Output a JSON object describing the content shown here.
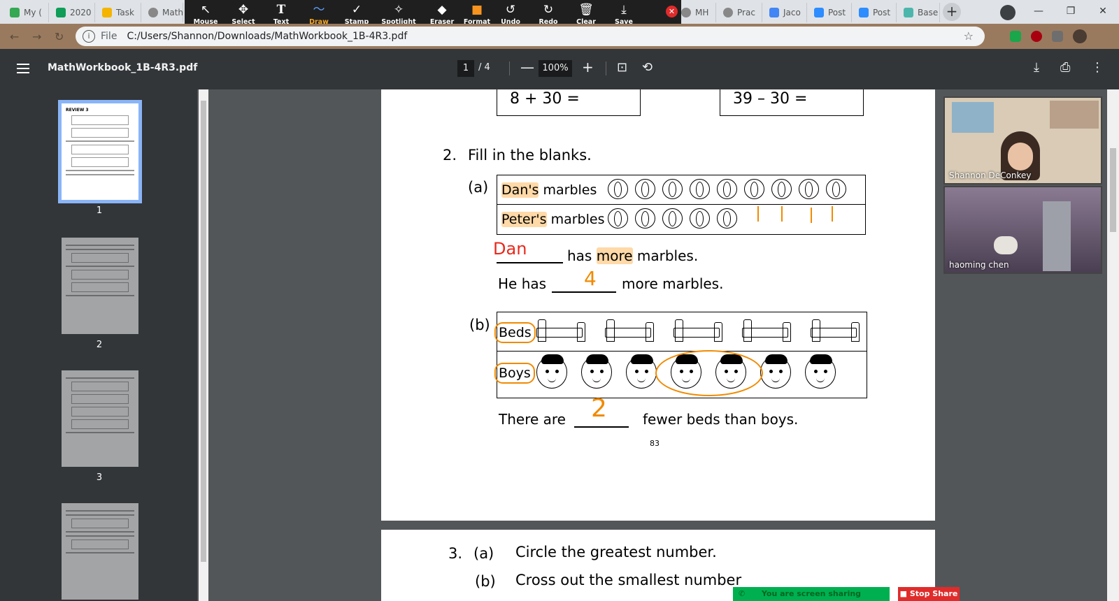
{
  "browser": {
    "tabs": [
      {
        "label": "My (",
        "icon": "drive-icon",
        "color": "#34a853"
      },
      {
        "label": "2020",
        "icon": "sheets-icon",
        "color": "#0f9d58"
      },
      {
        "label": "Task",
        "icon": "classroom-icon",
        "color": "#f4b400"
      },
      {
        "label": "Math",
        "icon": "web-icon",
        "color": "#888888"
      },
      {
        "label": "MH",
        "icon": "web-icon",
        "color": "#888888"
      },
      {
        "label": "Prac",
        "icon": "web-icon",
        "color": "#888888"
      },
      {
        "label": "Jaco",
        "icon": "docs-icon",
        "color": "#4285f4"
      },
      {
        "label": "Post",
        "icon": "zoom-icon",
        "color": "#2d8cff"
      },
      {
        "label": "Post",
        "icon": "zoom-icon",
        "color": "#2d8cff"
      },
      {
        "label": "Base",
        "icon": "bot-icon",
        "color": "#4db6ac"
      }
    ],
    "new_tab": "+",
    "url_scheme": "File",
    "url": "C:/Users/Shannon/Downloads/MathWorkbook_1B-4R3.pdf"
  },
  "zoom_toolbar": {
    "tools": [
      {
        "label": "Mouse",
        "icon": "↖"
      },
      {
        "label": "Select",
        "icon": "✥"
      },
      {
        "label": "Text",
        "icon": "T"
      },
      {
        "label": "Draw",
        "icon": "〜"
      },
      {
        "label": "Stamp",
        "icon": "✓"
      },
      {
        "label": "Spotlight",
        "icon": "✧"
      },
      {
        "label": "Eraser",
        "icon": "◆"
      },
      {
        "label": "Format",
        "icon": "■"
      },
      {
        "label": "Undo",
        "icon": "↺"
      },
      {
        "label": "Redo",
        "icon": "↻"
      },
      {
        "label": "Clear",
        "icon": "🗑"
      },
      {
        "label": "Save",
        "icon": "⤓"
      }
    ],
    "active_tool": "Draw",
    "close": "✕",
    "format_color": "#f7931e"
  },
  "pdf_toolbar": {
    "filename": "MathWorkbook_1B-4R3.pdf",
    "current_page": "1",
    "total_pages": "/ 4",
    "zoom": "100%",
    "zoom_out": "—",
    "zoom_in": "+"
  },
  "thumbnails": [
    {
      "number": "1",
      "heading": "REVIEW 3"
    },
    {
      "number": "2"
    },
    {
      "number": "3"
    },
    {
      "number": "4"
    }
  ],
  "page": {
    "eq_left": "8  +  30  =",
    "eq_right": "39  –  30  =",
    "q2_number": "2.",
    "q2_title": "Fill in the blanks.",
    "part_a": "(a)",
    "dans_label": "Dan's",
    "marbles_word": "marbles",
    "peters_label": "Peter's",
    "dan_marble_count": 9,
    "peter_marble_count": 5,
    "answer_dan": "Dan",
    "sentence_has": "has",
    "sentence_more": "more",
    "sentence_marbles": "marbles.",
    "he_has": "He has",
    "answer_4": "4",
    "more_marbles": "more marbles.",
    "part_b": "(b)",
    "beds_label": "Beds",
    "boys_label": "Boys",
    "bed_count": 5,
    "boy_count": 7,
    "there_are": "There are",
    "answer_2": "2",
    "fewer_text": "fewer beds than boys.",
    "page_number": "83",
    "q3_number": "3.",
    "q3_a": "(a)",
    "q3_a_text": "Circle the greatest number.",
    "q3_b": "(b)",
    "q3_b_text": "Cross out the smallest number"
  },
  "video": {
    "participants": [
      {
        "name": "Shannon DeConkey"
      },
      {
        "name": "haoming chen"
      }
    ]
  },
  "share": {
    "status": "You are screen sharing",
    "stop": "Stop Share"
  },
  "colors": {
    "annotation_orange": "#f08a00",
    "annotation_red": "#e8291c",
    "highlight": "#ffd9a8"
  }
}
